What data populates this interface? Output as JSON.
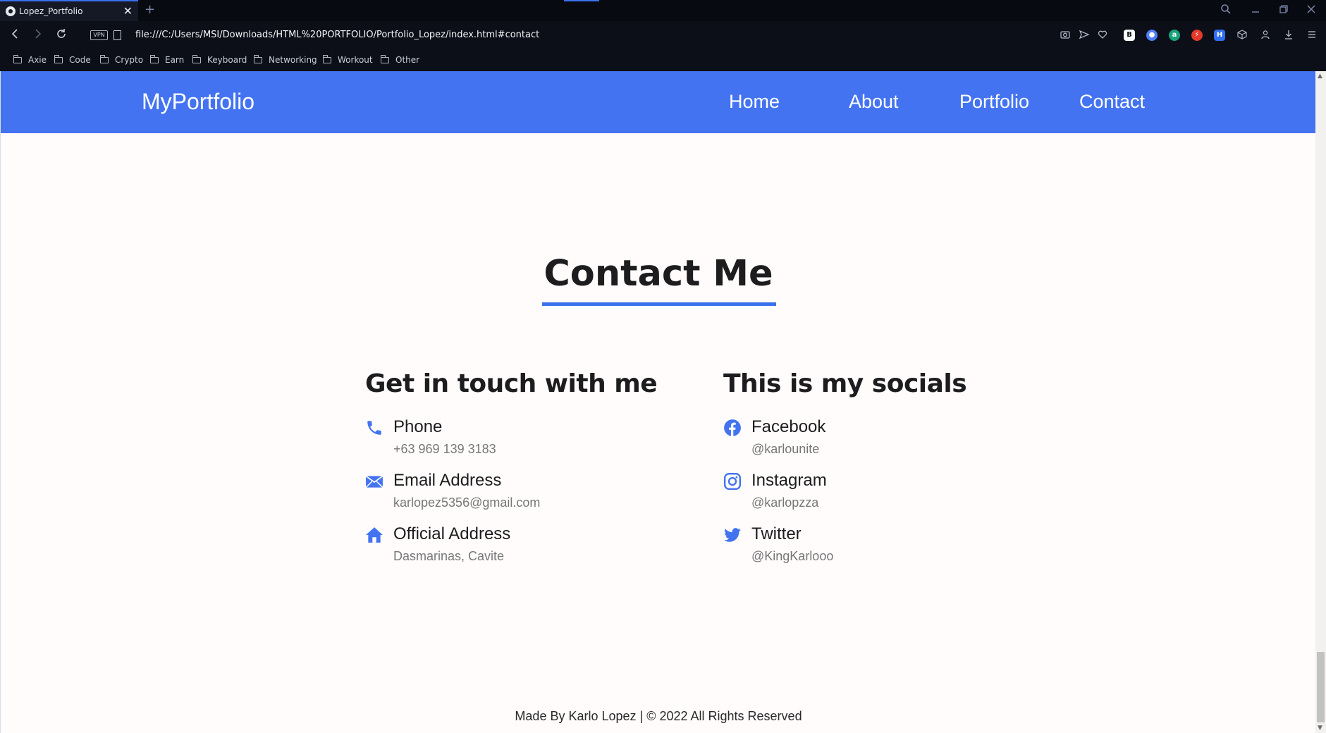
{
  "browser": {
    "tab_title": "Lopez_Portfolio",
    "tab_close": "✕",
    "new_tab": "+",
    "url": "file:///C:/Users/MSI/Downloads/HTML%20PORTFOLIO/Portfolio_Lopez/index.html#contact",
    "vpn_label": "VPN",
    "bookmarks": [
      "Axie",
      "Code",
      "Crypto",
      "Earn",
      "Keyboard",
      "Networking",
      "Workout",
      "Other"
    ],
    "accent": "#3a71ee"
  },
  "header": {
    "brand": "MyPortfolio",
    "nav": [
      "Home",
      "About",
      "Portfolio",
      "Contact"
    ],
    "background": "#4373f0"
  },
  "contact": {
    "title": "Contact Me",
    "left": {
      "title": "Get in touch with me",
      "items": [
        {
          "icon": "phone-icon",
          "label": "Phone",
          "value": "+63 969 139 3183"
        },
        {
          "icon": "envelope-icon",
          "label": "Email Address",
          "value": "karlopez5356@gmail.com"
        },
        {
          "icon": "home-icon",
          "label": "Official Address",
          "value": "Dasmarinas, Cavite"
        }
      ]
    },
    "right": {
      "title": "This is my socials",
      "items": [
        {
          "icon": "facebook-icon",
          "label": "Facebook",
          "value": "@karlounite"
        },
        {
          "icon": "instagram-icon",
          "label": "Instagram",
          "value": "@karlopzza"
        },
        {
          "icon": "twitter-icon",
          "label": "Twitter",
          "value": "@KingKarlooo"
        }
      ]
    }
  },
  "footer": {
    "text": "Made By Karlo Lopez | © 2022 All Rights Reserved"
  }
}
